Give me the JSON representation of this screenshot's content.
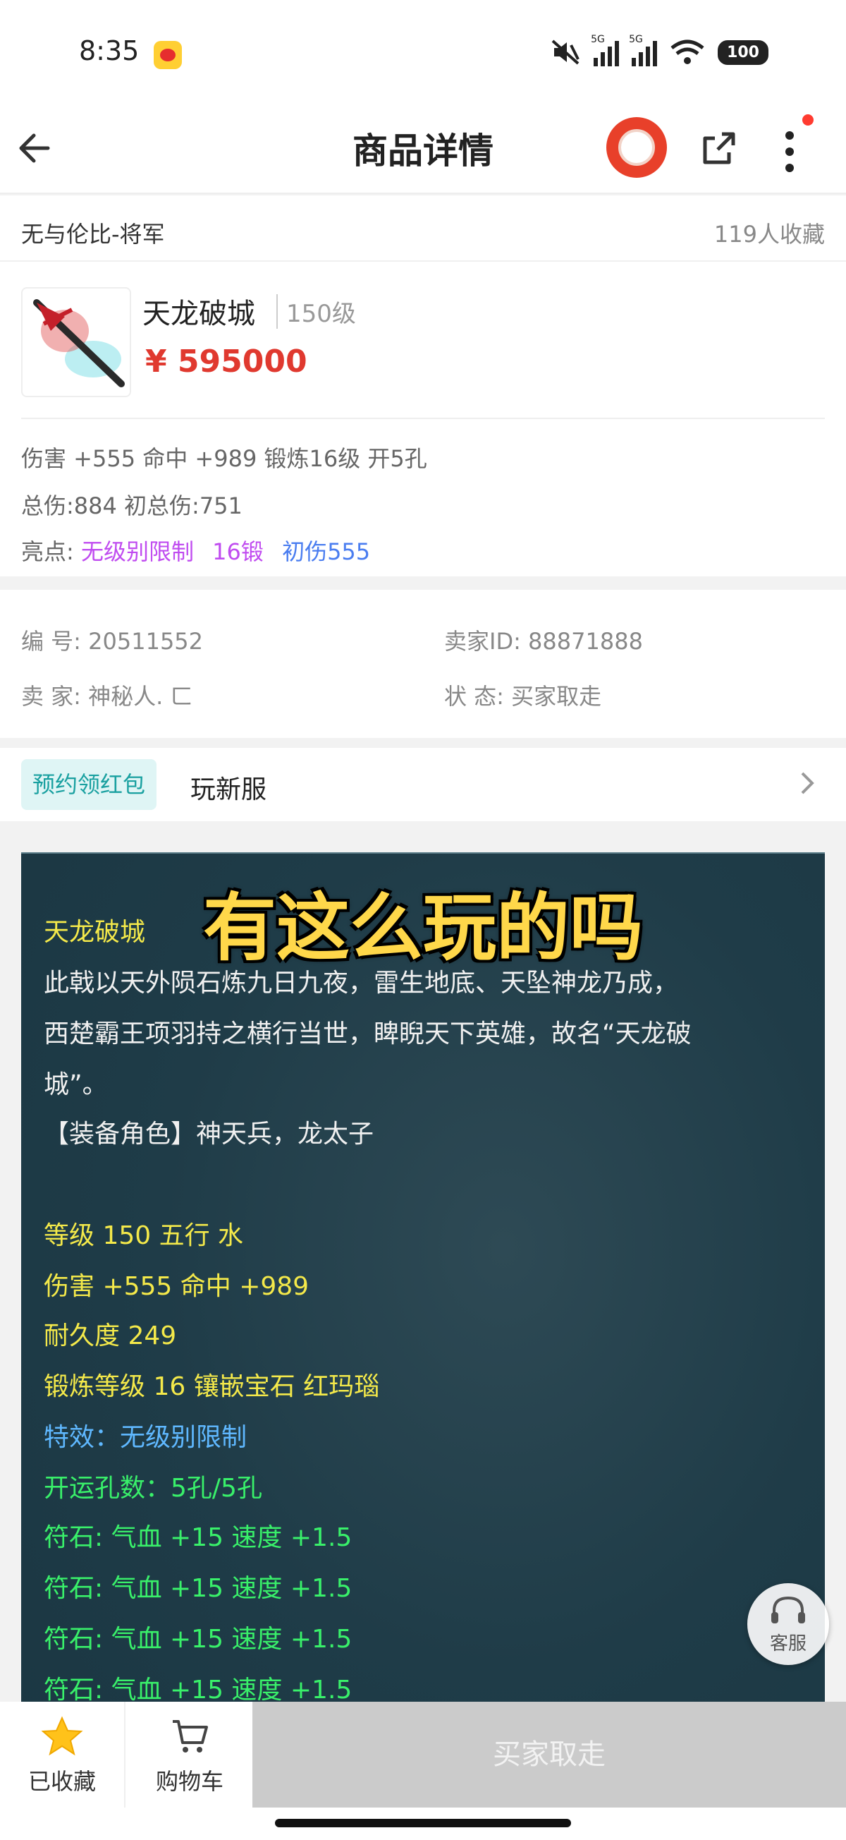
{
  "status_bar": {
    "time": "8:35",
    "battery": "100",
    "signal1": "5G",
    "signal2": "5G"
  },
  "header": {
    "title": "商品详情"
  },
  "product": {
    "store_name": "无与伦比-将军",
    "fav_count": "119人收藏",
    "name": "天龙破城",
    "level": "150级",
    "price": "¥ 595000",
    "attr_line1": "伤害 +555 命中 +989 锻炼16级 开5孔",
    "attr_line2": "总伤:884 初总伤:751",
    "highlights_label": "亮点:",
    "highlights": [
      "无级别限制",
      "16锻",
      "初伤555"
    ]
  },
  "info": {
    "id_label": "编 号:",
    "id_value": "20511552",
    "seller_id_label": "卖家ID:",
    "seller_id_value": "88871888",
    "seller_label": "卖 家:",
    "seller_value": "神秘人. ㄈ",
    "status_label": "状 态:",
    "status_value": "买家取走"
  },
  "promo": {
    "tag": "预约领红包",
    "text": "玩新服"
  },
  "overlay_caption": "有这么玩的吗",
  "description": [
    {
      "text": "天龙破城",
      "color": "yellow"
    },
    {
      "text": "此戟以天外陨石炼九日九夜，雷生地底、天坠神龙乃成，",
      "color": "white"
    },
    {
      "text": "西楚霸王项羽持之横行当世，睥睨天下英雄，故名“天龙破",
      "color": "white"
    },
    {
      "text": "城”。",
      "color": "white"
    },
    {
      "text": "【装备角色】神天兵，龙太子",
      "color": "white"
    },
    {
      "text": "等级 150 五行 水",
      "color": "yellow"
    },
    {
      "text": "伤害 +555 命中 +989",
      "color": "yellow"
    },
    {
      "text": "耐久度 249",
      "color": "yellow"
    },
    {
      "text": "锻炼等级 16 镶嵌宝石 红玛瑙",
      "color": "yellow"
    },
    {
      "text": "特效：无级别限制",
      "color": "blue"
    },
    {
      "text": "开运孔数：5孔/5孔",
      "color": "green"
    },
    {
      "text": "符石: 气血 +15 速度 +1.5",
      "color": "green"
    },
    {
      "text": "符石: 气血 +15 速度 +1.5",
      "color": "green"
    },
    {
      "text": "符石: 气血 +15 速度 +1.5",
      "color": "green"
    },
    {
      "text": "符石: 气血 +15 速度 +1.5",
      "color": "green"
    }
  ],
  "customer_service": "客服",
  "bottom": {
    "fav_label": "已收藏",
    "cart_label": "购物车",
    "buy_label": "买家取走"
  },
  "colors": {
    "price": "#e0392f",
    "panel_bg": "#1f3c48",
    "overlay": "#ffd84a"
  }
}
